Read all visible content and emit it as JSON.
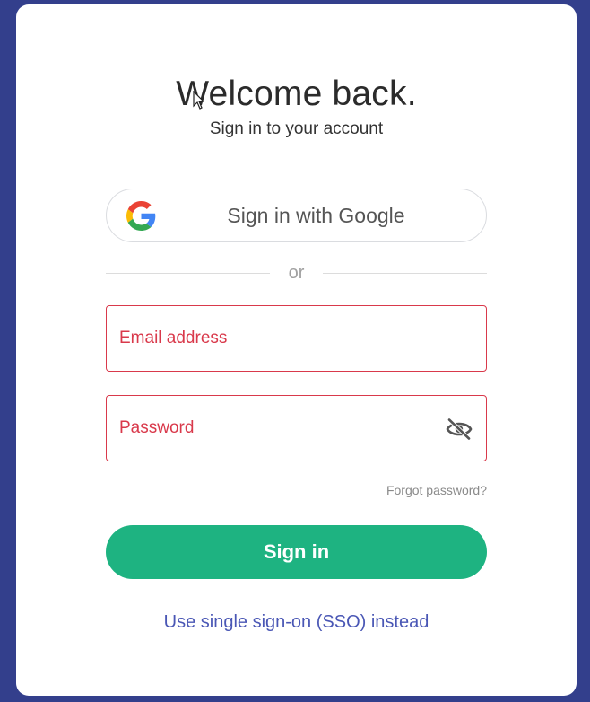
{
  "header": {
    "title": "Welcome back.",
    "subtitle": "Sign in to your account"
  },
  "google": {
    "label": "Sign in with Google",
    "icon": "google-icon"
  },
  "divider": {
    "text": "or"
  },
  "email": {
    "placeholder": "Email address",
    "value": ""
  },
  "password": {
    "placeholder": "Password",
    "value": "",
    "toggle_icon": "eye-off-icon"
  },
  "links": {
    "forgot": "Forgot password?",
    "sso": "Use single sign-on (SSO) instead"
  },
  "actions": {
    "signin_label": "Sign in"
  },
  "colors": {
    "background": "#333f8c",
    "accent": "#1eb381",
    "error": "#d9394b",
    "link": "#4a57b5"
  }
}
